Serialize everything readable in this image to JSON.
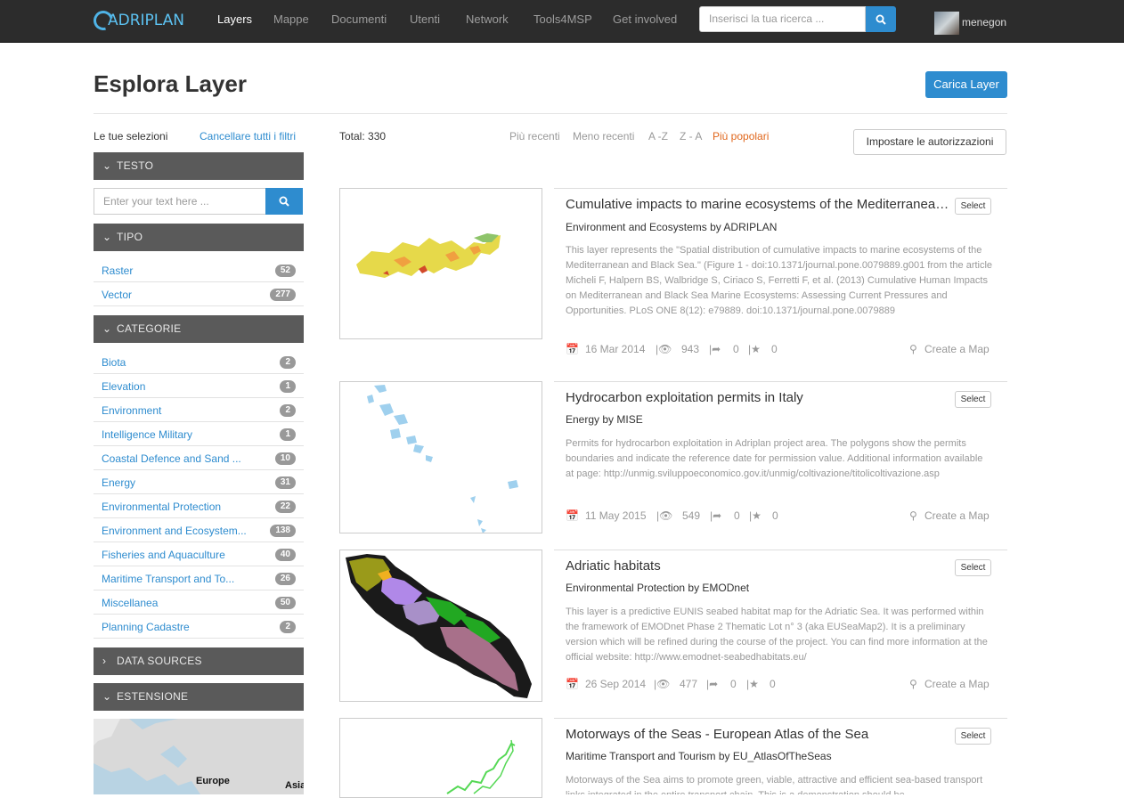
{
  "nav": {
    "logo_text": "ADRIPLAN",
    "items": [
      "Layers",
      "Mappe",
      "Documenti",
      "Utenti",
      "Network",
      "Tools4MSP",
      "Get involved"
    ],
    "search_placeholder": "Inserisci la tua ricerca ...",
    "username": "menegon"
  },
  "page": {
    "title": "Esplora Layer",
    "upload_label": "Carica Layer"
  },
  "sidebar": {
    "selections_label": "Le tue selezioni",
    "clear_label": "Cancellare tutti i filtri",
    "text_head": "TESTO",
    "text_placeholder": "Enter your text here ...",
    "type_head": "TIPO",
    "types": [
      {
        "label": "Raster",
        "count": "52"
      },
      {
        "label": "Vector",
        "count": "277"
      }
    ],
    "cat_head": "CATEGORIE",
    "categories": [
      {
        "label": "Biota",
        "count": "2"
      },
      {
        "label": "Elevation",
        "count": "1"
      },
      {
        "label": "Environment",
        "count": "2"
      },
      {
        "label": "Intelligence Military",
        "count": "1"
      },
      {
        "label": "Coastal Defence and Sand ...",
        "count": "10"
      },
      {
        "label": "Energy",
        "count": "31"
      },
      {
        "label": "Environmental Protection",
        "count": "22"
      },
      {
        "label": "Environment and Ecosystem...",
        "count": "138"
      },
      {
        "label": "Fisheries and Aquaculture",
        "count": "40"
      },
      {
        "label": "Maritime Transport and To...",
        "count": "26"
      },
      {
        "label": "Miscellanea",
        "count": "50"
      },
      {
        "label": "Planning Cadastre",
        "count": "2"
      }
    ],
    "sources_head": "DATA SOURCES",
    "extent_head": "ESTENSIONE",
    "map_labels": [
      "Europe",
      "Asia"
    ]
  },
  "results": {
    "total": "Total: 330",
    "sort": [
      "Più recenti",
      "Meno recenti",
      "A -Z",
      "Z - A",
      "Più popolari"
    ],
    "sort_active": "Più popolari",
    "permissions_label": "Impostare le autorizzazioni",
    "select_label": "Select",
    "create_map_label": "Create a Map",
    "layers": [
      {
        "title": "Cumulative impacts to marine ecosystems of the Mediterranean and Black Sea",
        "subtitle": "Environment and Ecosystems by ADRIPLAN",
        "description": "This layer represents the \"Spatial distribution of cumulative impacts to marine ecosystems of the Mediterranean and Black Sea.\" (Figure 1 - doi:10.1371/journal.pone.0079889.g001 from the article Micheli F, Halpern BS, Walbridge S, Ciriaco S, Ferretti F, et al. (2013) Cumulative Human Impacts on Mediterranean and Black Sea Marine Ecosystems: Assessing Current Pressures and Opportunities. PLoS ONE 8(12): e79889. doi:10.1371/journal.pone.0079889",
        "date": "16 Mar 2014",
        "views": "943",
        "shares": "0",
        "rating": "0"
      },
      {
        "title": "Hydrocarbon exploitation permits in Italy",
        "subtitle": "Energy by MISE",
        "description": "Permits for hydrocarbon exploitation in Adriplan project area.  The polygons show the permits boundaries and indicate the reference date for permission value. Additional information available at page: http://unmig.sviluppoeconomico.gov.it/unmig/coltivazione/titolicoltivazione.asp",
        "date": "11 May 2015",
        "views": "549",
        "shares": "0",
        "rating": "0"
      },
      {
        "title": "Adriatic habitats",
        "subtitle": "Environmental Protection by EMODnet",
        "description": "This layer is a predictive EUNIS seabed habitat map for the Adriatic Sea. It was performed within the framework of EMODnet Phase 2 Thematic Lot n° 3 (aka EUSeaMap2). It is a preliminary version which will be refined during the course of the project. You can find more information at the official website: http://www.emodnet-seabedhabitats.eu/",
        "date": "26 Sep 2014",
        "views": "477",
        "shares": "0",
        "rating": "0"
      },
      {
        "title": "Motorways of the Seas - European Atlas of the Sea",
        "subtitle": "Maritime Transport and Tourism by EU_AtlasOfTheSeas",
        "description": "Motorways of the Sea aims to promote green, viable, attractive and efficient sea-based transport links integrated in the entire transport chain. This is a demonstration should be",
        "date": "",
        "views": "",
        "shares": "",
        "rating": ""
      }
    ]
  }
}
